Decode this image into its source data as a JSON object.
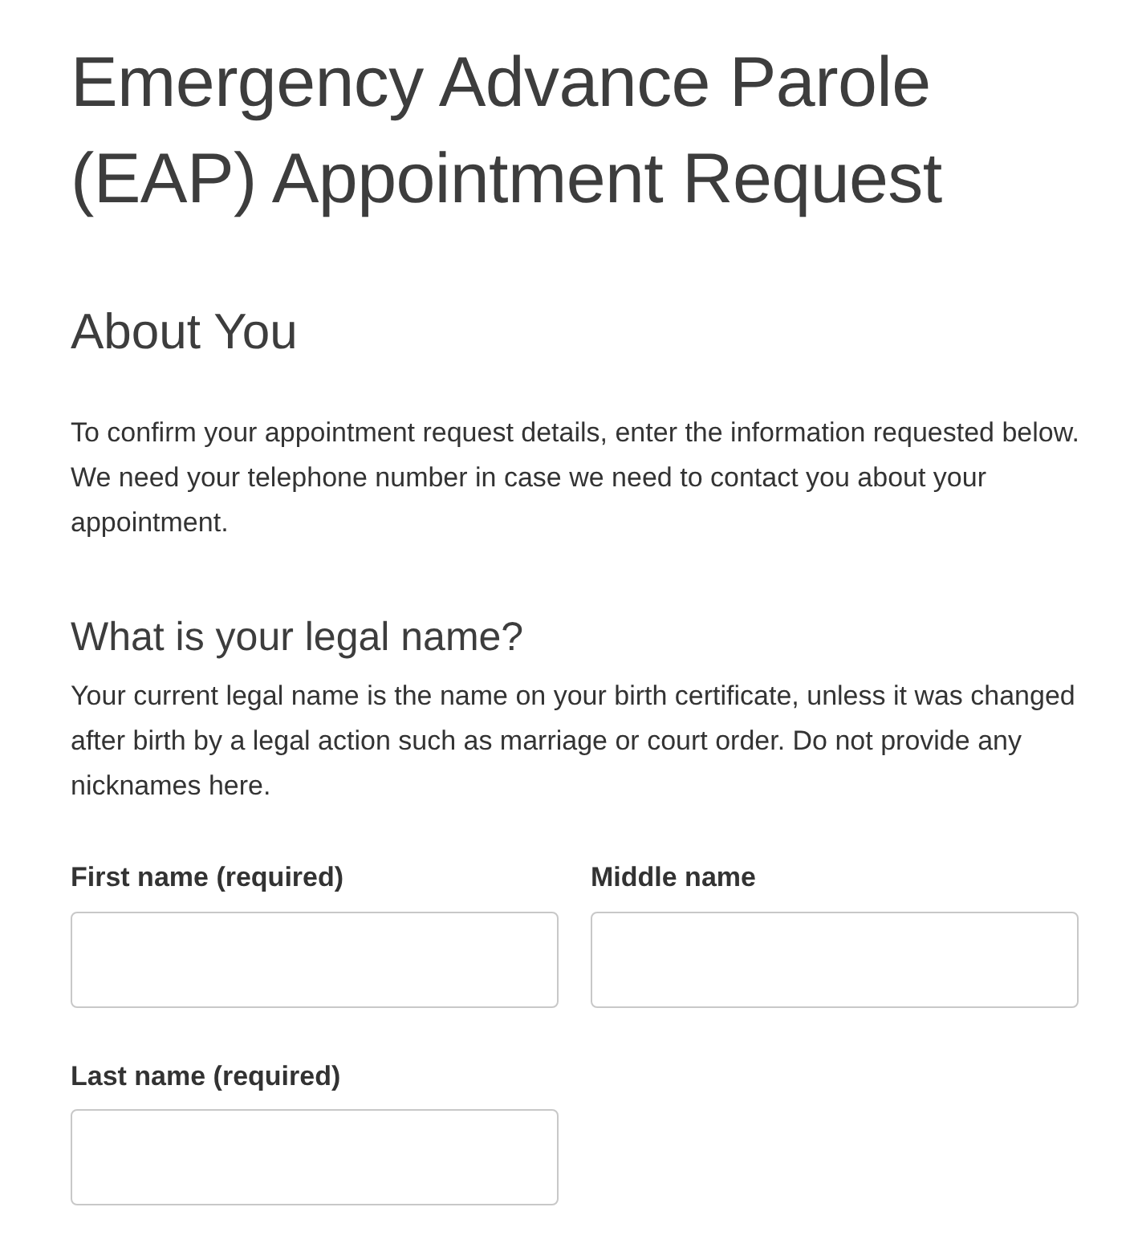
{
  "title": "Emergency Advance Parole (EAP) Appointment Request",
  "section": {
    "heading": "About You",
    "text": "To confirm your appointment request details, enter the information requested below. We need your telephone number in case we need to contact you about your appointment."
  },
  "question": {
    "heading": "What is your legal name?",
    "text": "Your current legal name is the name on your birth certificate, unless it was changed after birth by a legal action such as marriage or court order. Do not provide any nicknames here."
  },
  "field_rows": [
    {
      "fields": [
        {
          "label": "First name (required)"
        },
        {
          "label": "Middle name"
        }
      ]
    },
    {
      "fields": [
        {
          "label": "Last name (required)"
        }
      ]
    }
  ]
}
